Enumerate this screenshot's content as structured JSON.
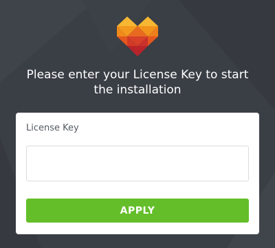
{
  "header": {
    "logo_icon": "heart-gem-logo-icon",
    "instruction": "Please enter your License Key to start the installation"
  },
  "form": {
    "label": "License Key",
    "input_value": "",
    "input_placeholder": "",
    "apply_label": "APPLY"
  },
  "colors": {
    "background": "#3a3e45",
    "card": "#ffffff",
    "button": "#64be2a",
    "logo_orange": "#f39a1e",
    "logo_red": "#d8402a"
  }
}
